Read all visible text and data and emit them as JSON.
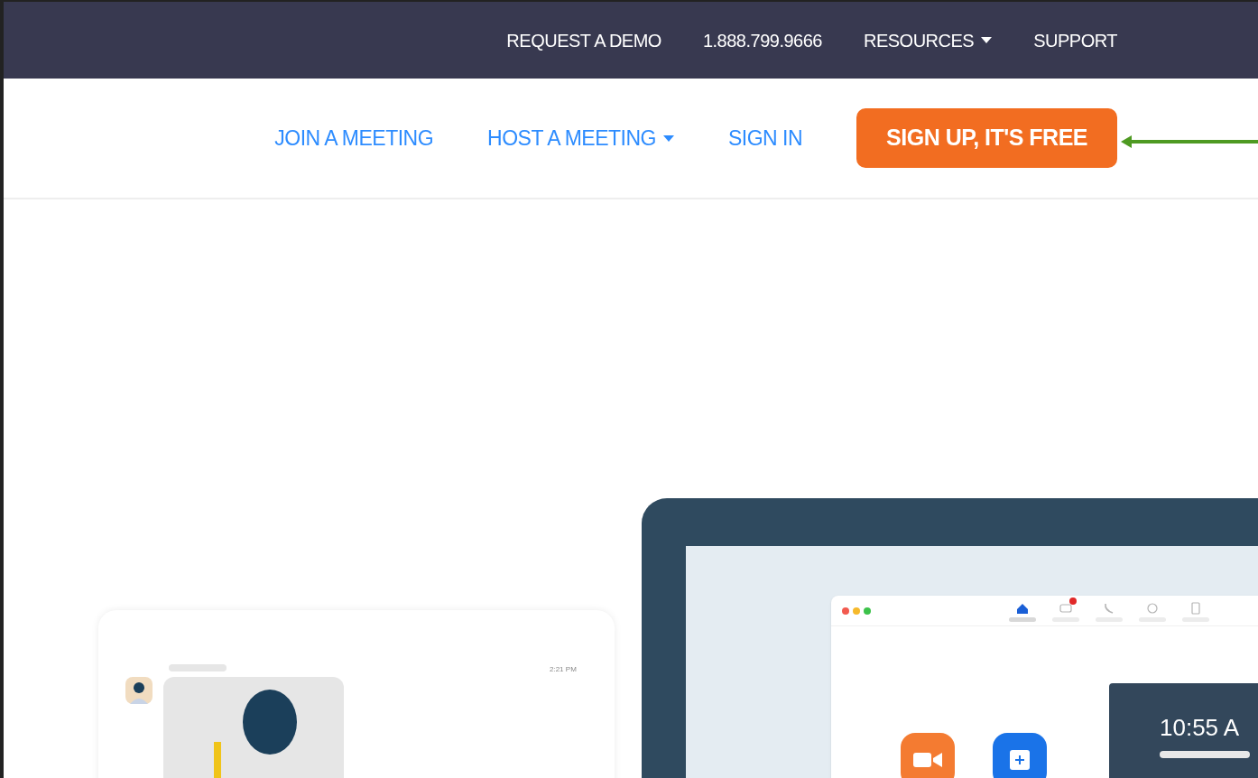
{
  "top_bar": {
    "links": [
      {
        "label": "REQUEST A DEMO",
        "dropdown": false
      },
      {
        "label": "1.888.799.9666",
        "dropdown": false
      },
      {
        "label": "RESOURCES",
        "dropdown": true
      },
      {
        "label": "SUPPORT",
        "dropdown": false
      }
    ]
  },
  "main_nav": {
    "links": [
      {
        "label": "JOIN A MEETING",
        "dropdown": false
      },
      {
        "label": "HOST A MEETING",
        "dropdown": true
      },
      {
        "label": "SIGN IN",
        "dropdown": false
      }
    ],
    "cta": "SIGN UP, IT'S FREE"
  },
  "chat_card": {
    "time": "2:21 PM"
  },
  "app_window": {
    "tabs": [
      {
        "kind": "home",
        "selected": true,
        "badge": false
      },
      {
        "kind": "chat",
        "selected": false,
        "badge": true
      },
      {
        "kind": "phone",
        "selected": false,
        "badge": false
      },
      {
        "kind": "clock",
        "selected": false,
        "badge": false
      },
      {
        "kind": "contacts",
        "selected": false,
        "badge": false
      }
    ],
    "clock": "10:55 A"
  }
}
